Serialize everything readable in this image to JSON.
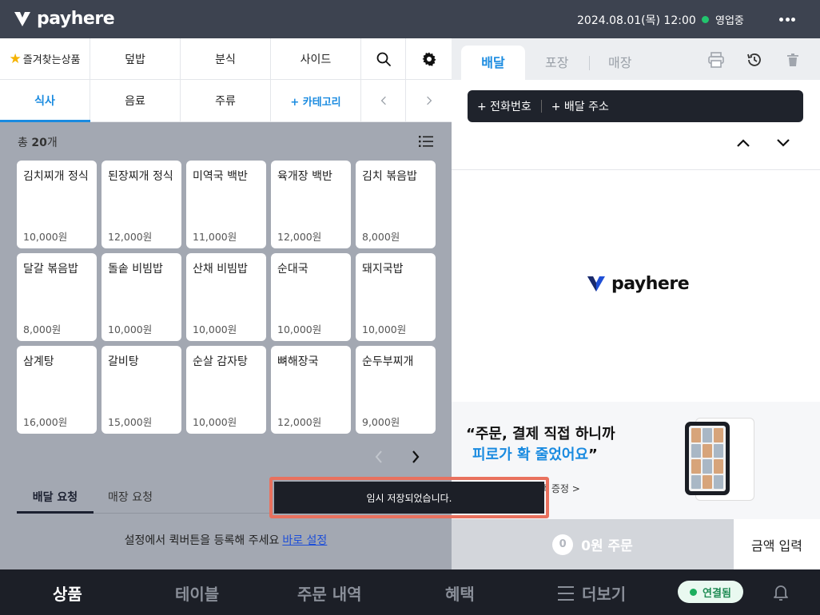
{
  "topbar": {
    "logo_text": "payhere",
    "datetime": "2024.08.01(목) 12:00",
    "status": "영업중",
    "status_color": "#22c56e"
  },
  "categories": {
    "row1": [
      {
        "label": "즐겨찾는상품",
        "favorite": true
      },
      {
        "label": "덮밥"
      },
      {
        "label": "분식"
      },
      {
        "label": "사이드"
      }
    ],
    "row2": [
      {
        "label": "식사",
        "active": true
      },
      {
        "label": "음료"
      },
      {
        "label": "주류"
      },
      {
        "label": "+ 카테고리"
      }
    ],
    "icons": [
      "search-icon",
      "gear-icon",
      "chevron-left-icon",
      "chevron-right-icon"
    ]
  },
  "products": {
    "total_prefix": "총",
    "total_count": "20",
    "total_suffix": "개",
    "items": [
      {
        "name": "김치찌개 정식",
        "price": "10,000원"
      },
      {
        "name": "된장찌개 정식",
        "price": "12,000원"
      },
      {
        "name": "미역국 백반",
        "price": "11,000원"
      },
      {
        "name": "육개장 백반",
        "price": "12,000원"
      },
      {
        "name": "김치 볶음밥",
        "price": "8,000원"
      },
      {
        "name": "달갈 볶음밥",
        "price": "8,000원"
      },
      {
        "name": "돌솥 비빔밥",
        "price": "10,000원"
      },
      {
        "name": "산채 비빔밥",
        "price": "10,000원"
      },
      {
        "name": "순대국",
        "price": "10,000원"
      },
      {
        "name": "돼지국밥",
        "price": "10,000원"
      },
      {
        "name": "삼계탕",
        "price": "16,000원"
      },
      {
        "name": "갈비탕",
        "price": "15,000원"
      },
      {
        "name": "순살 감자탕",
        "price": "10,000원"
      },
      {
        "name": "뼈해장국",
        "price": "12,000원"
      },
      {
        "name": "순두부찌개",
        "price": "9,000원"
      }
    ]
  },
  "requests": {
    "tabs": [
      "배달 요청",
      "매장 요청"
    ],
    "message": "설정에서 퀵버튼을 등록해 주세요",
    "link": "바로 설정"
  },
  "order_panel": {
    "tabs": [
      "배달",
      "포장",
      "매장"
    ],
    "phone_btn": "+ 전화번호",
    "address_btn": "+ 배달 주소",
    "brand": "payhere",
    "banner_line1": "“주문, 결제 직접 하니까",
    "banner_line2": "피로가 확 줄었어요",
    "banner_quote_close": "”",
    "banner_cta": "택 증정 >",
    "order_count": "0",
    "order_label": "0원 주문",
    "amount_btn": "금액 입력"
  },
  "toast": "임시 저장되었습니다.",
  "bottomnav": {
    "items": [
      "상품",
      "테이블",
      "주문 내역",
      "혜택",
      "더보기"
    ],
    "connected": "연결됨"
  },
  "colors": {
    "accent": "#1a8be0",
    "topbar": "#3d4350",
    "bottomnav": "#1c1f27",
    "toast_border": "#e9715e"
  }
}
